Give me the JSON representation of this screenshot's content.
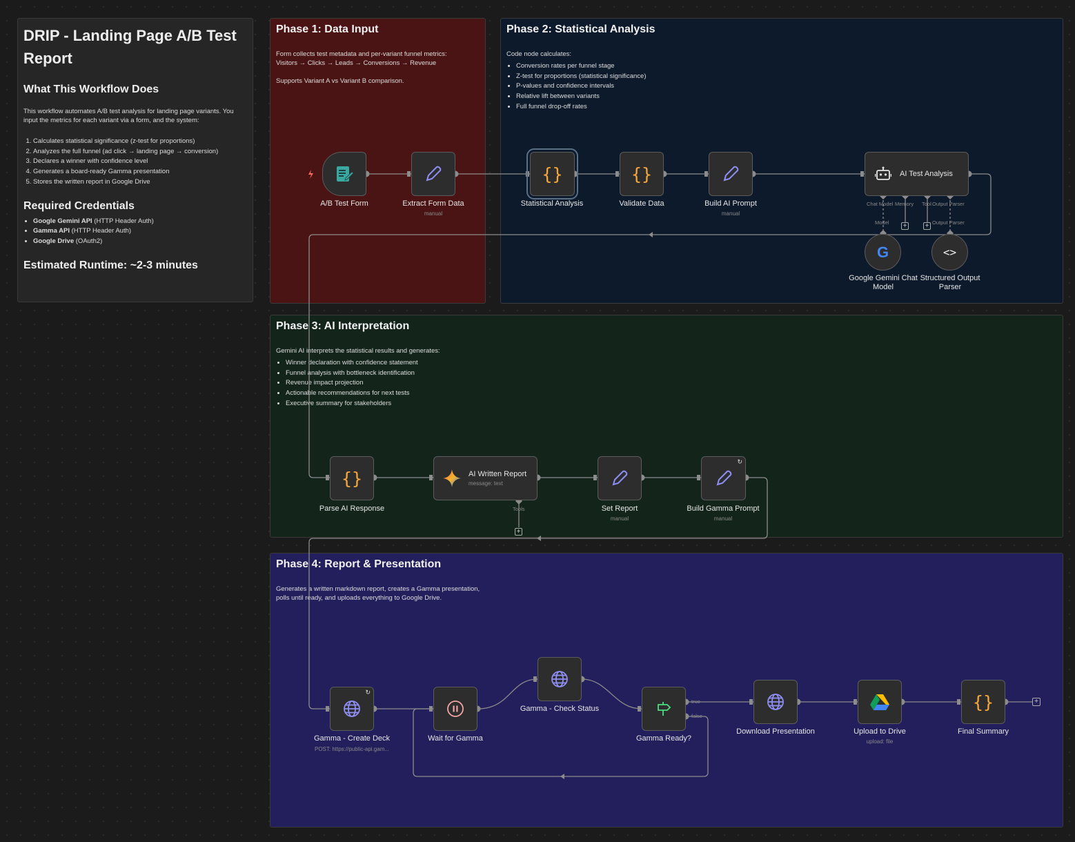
{
  "colors": {
    "phase1": "#4a1414",
    "phase2": "#0d1a2b",
    "phase3": "#13251b",
    "phase4": "#231f5c",
    "canvas": "#1b1b1b",
    "wire": "#8a8a8a"
  },
  "overview": {
    "title": "DRIP - Landing Page A/B Test Report",
    "what_heading": "What This Workflow Does",
    "intro": "This workflow automates A/B test analysis for landing page variants. You input the metrics for each variant via a form, and the system:",
    "steps": [
      "Calculates statistical significance (z-test for proportions)",
      "Analyzes the full funnel (ad click → landing page → conversion)",
      "Declares a winner with confidence level",
      "Generates a board-ready Gamma presentation",
      "Stores the written report in Google Drive"
    ],
    "cred_heading": "Required Credentials",
    "credentials": [
      {
        "name": "Google Gemini API",
        "detail": " (HTTP Header Auth)"
      },
      {
        "name": "Gamma API",
        "detail": " (HTTP Header Auth)"
      },
      {
        "name": "Google Drive",
        "detail": " (OAuth2)"
      }
    ],
    "runtime": "Estimated Runtime: ~2-3 minutes"
  },
  "phase1": {
    "title": "Phase 1: Data Input",
    "line1": "Form collects test metadata and per-variant funnel metrics:",
    "line2": "Visitors → Clicks → Leads → Conversions → Revenue",
    "line3": "Supports Variant A vs Variant B comparison."
  },
  "phase2": {
    "title": "Phase 2: Statistical Analysis",
    "intro": "Code node calculates:",
    "items": [
      "Conversion rates per funnel stage",
      "Z-test for proportions (statistical significance)",
      "P-values and confidence intervals",
      "Relative lift between variants",
      "Full funnel drop-off rates"
    ]
  },
  "phase3": {
    "title": "Phase 3: AI Interpretation",
    "intro": "Gemini AI interprets the statistical results and generates:",
    "items": [
      "Winner declaration with confidence statement",
      "Funnel analysis with bottleneck identification",
      "Revenue impact projection",
      "Actionable recommendations for next tests",
      "Executive summary for stakeholders"
    ]
  },
  "phase4": {
    "title": "Phase 4: Report & Presentation",
    "line1": "Generates a written markdown report, creates a Gamma presentation,",
    "line2": "polls until ready, and uploads everything to Google Drive."
  },
  "nodes": {
    "ab_form": {
      "label": "A/B Test Form",
      "icon": "form-icon"
    },
    "extract": {
      "label": "Extract Form Data",
      "sub": "manual",
      "icon": "pencil-icon"
    },
    "stat": {
      "label": "Statistical Analysis",
      "icon": "code-braces-icon"
    },
    "validate": {
      "label": "Validate Data",
      "icon": "code-braces-icon"
    },
    "build_ai": {
      "label": "Build AI Prompt",
      "sub": "manual",
      "icon": "pencil-icon"
    },
    "ai_test": {
      "label": "AI Test Analysis",
      "icon": "robot-icon",
      "port1": "Chat Model",
      "port2": "Memory",
      "port3": "Tool",
      "port4": "Output Parser"
    },
    "gemini": {
      "label1": "Google Gemini Chat",
      "label2": "Model",
      "port": "Model",
      "icon": "google-icon"
    },
    "parser": {
      "label1": "Structured Output",
      "label2": "Parser",
      "port": "Output Parser",
      "icon": "code-angle-icon"
    },
    "parse_ai": {
      "label": "Parse AI Response",
      "icon": "code-braces-icon"
    },
    "written": {
      "label": "AI Written Report",
      "sub": "message: text",
      "port": "Tools",
      "icon": "gemini-star-icon"
    },
    "set_report": {
      "label": "Set Report",
      "sub": "manual",
      "icon": "pencil-icon"
    },
    "build_gamma": {
      "label": "Build Gamma Prompt",
      "sub": "manual",
      "icon": "pencil-icon"
    },
    "create_deck": {
      "label": "Gamma - Create Deck",
      "sub": "POST: https://public-api.gam...",
      "icon": "globe-icon"
    },
    "wait": {
      "label": "Wait for Gamma",
      "icon": "pause-icon"
    },
    "check": {
      "label": "Gamma - Check Status",
      "icon": "globe-icon"
    },
    "ready": {
      "label": "Gamma Ready?",
      "icon": "signpost-icon",
      "true_label": "true",
      "false_label": "false"
    },
    "download": {
      "label": "Download Presentation",
      "icon": "globe-icon"
    },
    "upload": {
      "label": "Upload to Drive",
      "sub": "upload: file",
      "icon": "google-drive-icon"
    },
    "final": {
      "label": "Final Summary",
      "icon": "code-braces-icon"
    }
  }
}
